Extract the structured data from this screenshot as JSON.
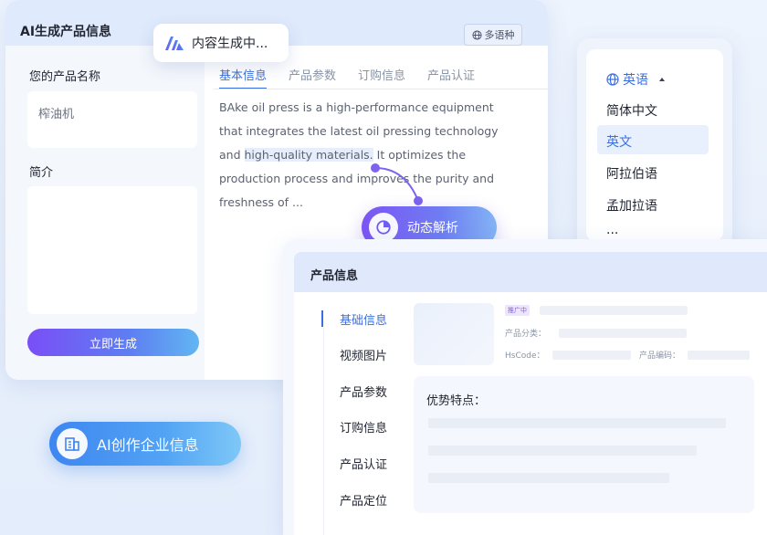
{
  "main_panel": {
    "title": "AI生成产品信息",
    "language_button": "多语种",
    "product_name_label": "您的产品名称",
    "product_name_value": "榨油机",
    "intro_label": "简介",
    "generate_button": "立即生成",
    "tabs": [
      {
        "label": "基本信息",
        "active": true
      },
      {
        "label": "产品参数",
        "active": false
      },
      {
        "label": "订购信息",
        "active": false
      },
      {
        "label": "产品认证",
        "active": false
      }
    ],
    "generated_text": {
      "part1": "BAke oil press is a high-performance equipment that integrates the latest oil pressing technology and ",
      "highlight": "high-quality materials.",
      "part2": " It optimizes the production process and improves the purity and freshness of ..."
    }
  },
  "generating_status": "内容生成中...",
  "analysis_button": "动态解析",
  "language_dropdown": {
    "selected": "英语",
    "options": [
      "简体中文",
      "英文",
      "阿拉伯语",
      "孟加拉语",
      "..."
    ],
    "active_option": "英文"
  },
  "product_info_panel": {
    "title": "产品信息",
    "nav": [
      "基础信息",
      "视频图片",
      "产品参数",
      "订购信息",
      "产品认证",
      "产品定位"
    ],
    "active_nav": "基础信息",
    "tag": "推广中",
    "category_label": "产品分类：",
    "hscode_label": "HsCode：",
    "product_code_label": "产品编码：",
    "advantages_label": "优势特点："
  },
  "enterprise_button": "AI创作企业信息",
  "colors": {
    "accent_blue": "#3b6fe0",
    "accent_purple": "#7c54f5",
    "panel_header": "#dfeafc"
  }
}
